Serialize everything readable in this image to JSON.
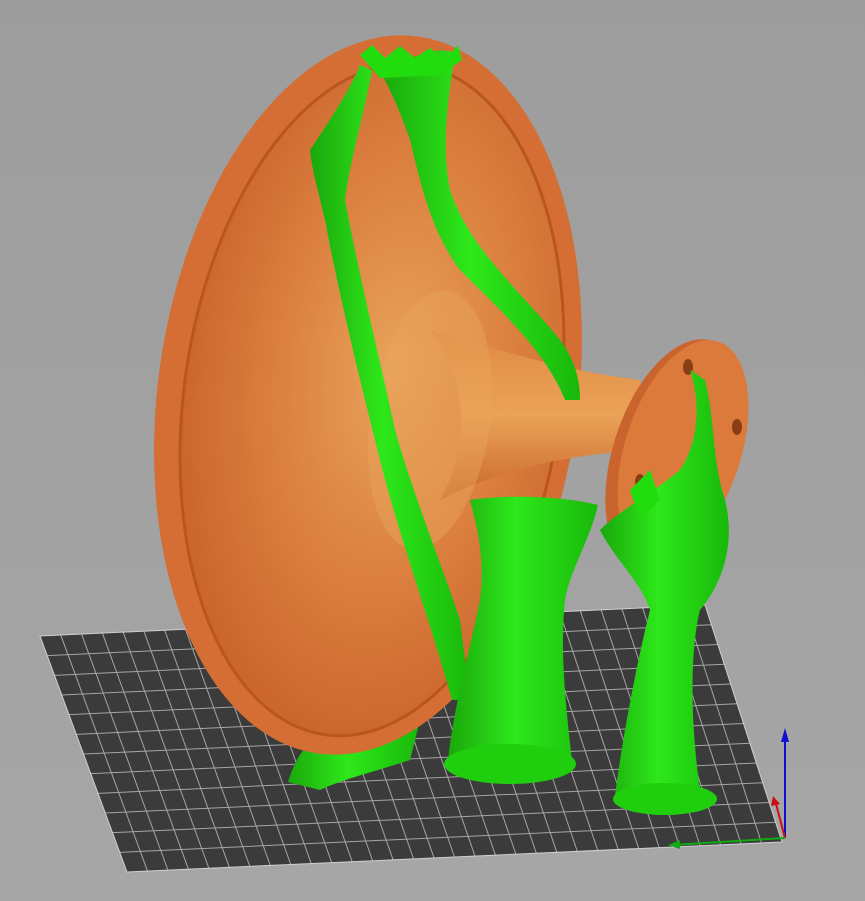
{
  "viewport": {
    "background_color": "#a0a0a0",
    "bed_color": "#3a3a3a",
    "bed_grid_color": "#9a9a9a",
    "model_color": "#d9743a",
    "model_highlight_color": "#e79a4c",
    "support_color": "#22dd0e",
    "support_shadow_color": "#16a80a",
    "axis_z_color": "#1010cc",
    "axis_x_color": "#cc1010",
    "axis_y_color": "#10aa10"
  },
  "scene": {
    "model": "horn-icon",
    "supports": "tree-supports-icon",
    "bed": "print-bed-grid",
    "axes": "axis-gizmo-icon"
  }
}
